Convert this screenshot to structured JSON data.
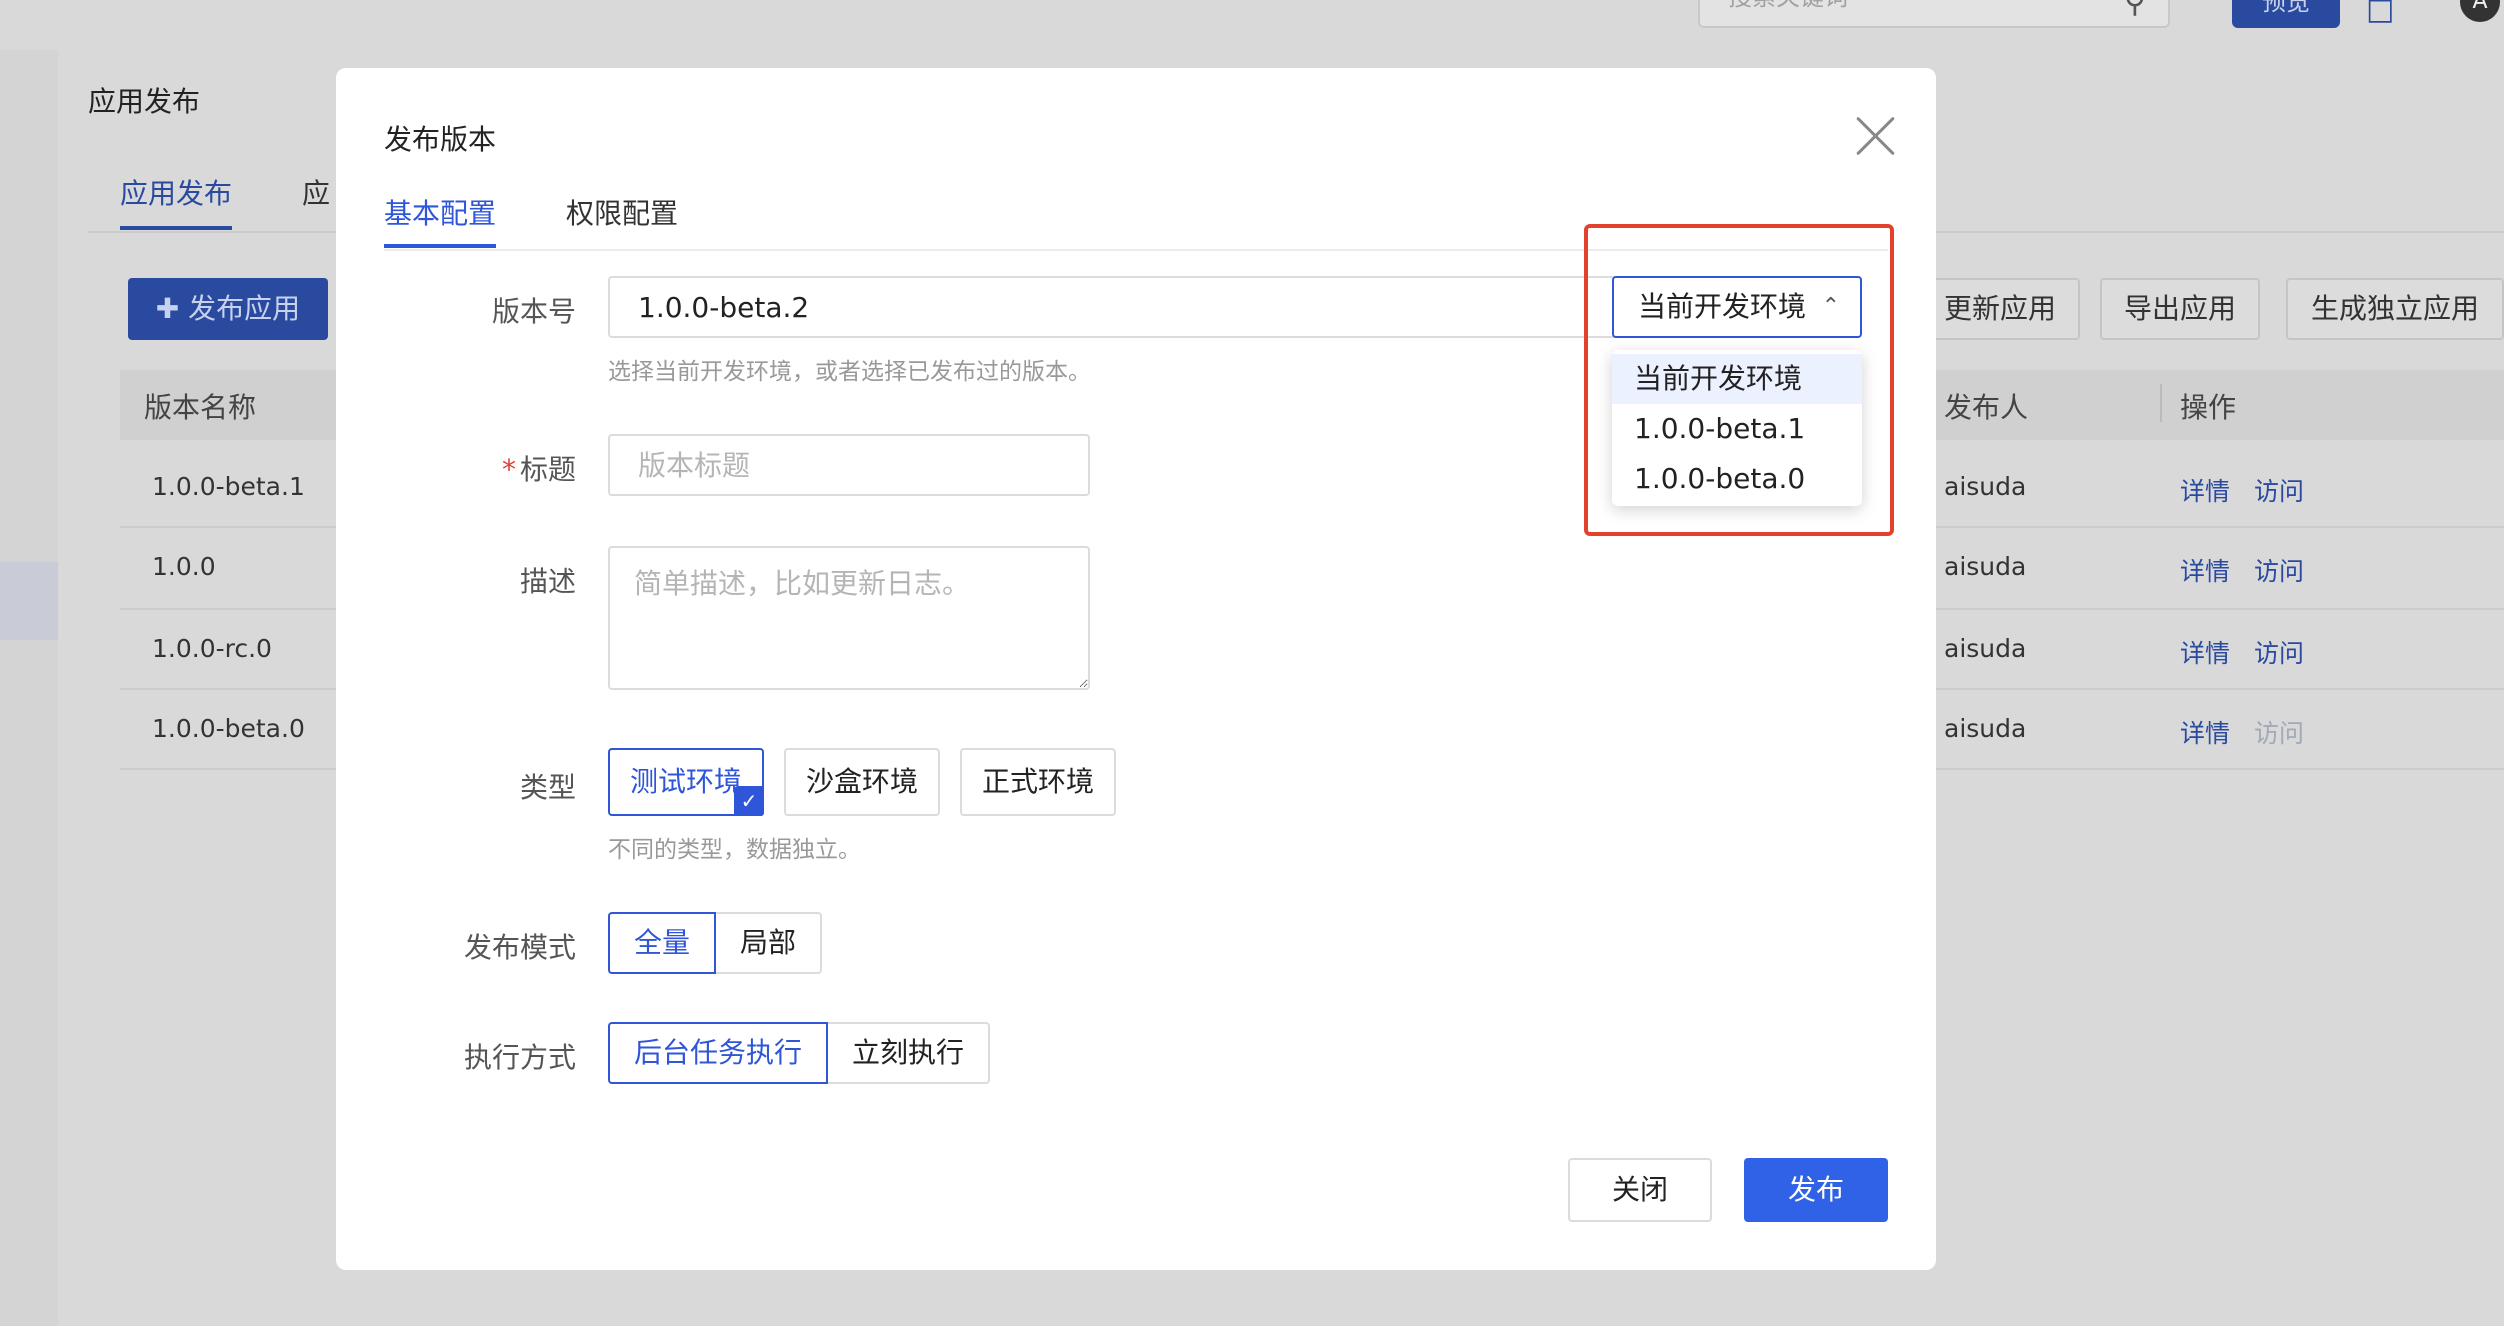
{
  "background": {
    "search_placeholder": "搜索关键词",
    "preview_label": "预览",
    "avatar_initial": "A",
    "breadcrumb": "应用发布",
    "tabs": [
      "应用发布",
      "应"
    ],
    "buttons": {
      "publish_app": "发布应用",
      "update_app": "更新应用",
      "export_app": "导出应用",
      "generate_standalone": "生成独立应用"
    },
    "table": {
      "columns": [
        "版本名称",
        "发布人",
        "操作"
      ],
      "rows": [
        {
          "version": "1.0.0-beta.1",
          "publisher": "aisuda",
          "detail": "详情",
          "visit": "访问"
        },
        {
          "version": "1.0.0",
          "publisher": "aisuda",
          "detail": "详情",
          "visit": "访问"
        },
        {
          "version": "1.0.0-rc.0",
          "publisher": "aisuda",
          "detail": "详情",
          "visit": "访问"
        },
        {
          "version": "1.0.0-beta.0",
          "publisher": "aisuda",
          "detail": "详情",
          "visit": "访问"
        }
      ]
    }
  },
  "modal": {
    "title": "发布版本",
    "tabs": [
      {
        "label": "基本配置",
        "active": true
      },
      {
        "label": "权限配置",
        "active": false
      }
    ],
    "version": {
      "label": "版本号",
      "value": "1.0.0-beta.2",
      "help": "选择当前开发环境，或者选择已发布过的版本。",
      "select": {
        "selected": "当前开发环境",
        "options": [
          "当前开发环境",
          "1.0.0-beta.1",
          "1.0.0-beta.0"
        ]
      }
    },
    "title_field": {
      "label": "标题",
      "required_mark": "*",
      "placeholder": "版本标题"
    },
    "desc_field": {
      "label": "描述",
      "placeholder": "简单描述，比如更新日志。"
    },
    "type_field": {
      "label": "类型",
      "options": [
        "测试环境",
        "沙盒环境",
        "正式环境"
      ],
      "selected": "测试环境",
      "help": "不同的类型，数据独立。"
    },
    "mode_field": {
      "label": "发布模式",
      "options": [
        "全量",
        "局部"
      ],
      "selected": "全量"
    },
    "exec_field": {
      "label": "执行方式",
      "options": [
        "后台任务执行",
        "立刻执行"
      ],
      "selected": "后台任务执行"
    },
    "footer": {
      "close": "关闭",
      "publish": "发布"
    }
  },
  "colors": {
    "accent": "#2f56d8",
    "primary_button": "#2f62e6",
    "highlight": "#e2422c"
  }
}
